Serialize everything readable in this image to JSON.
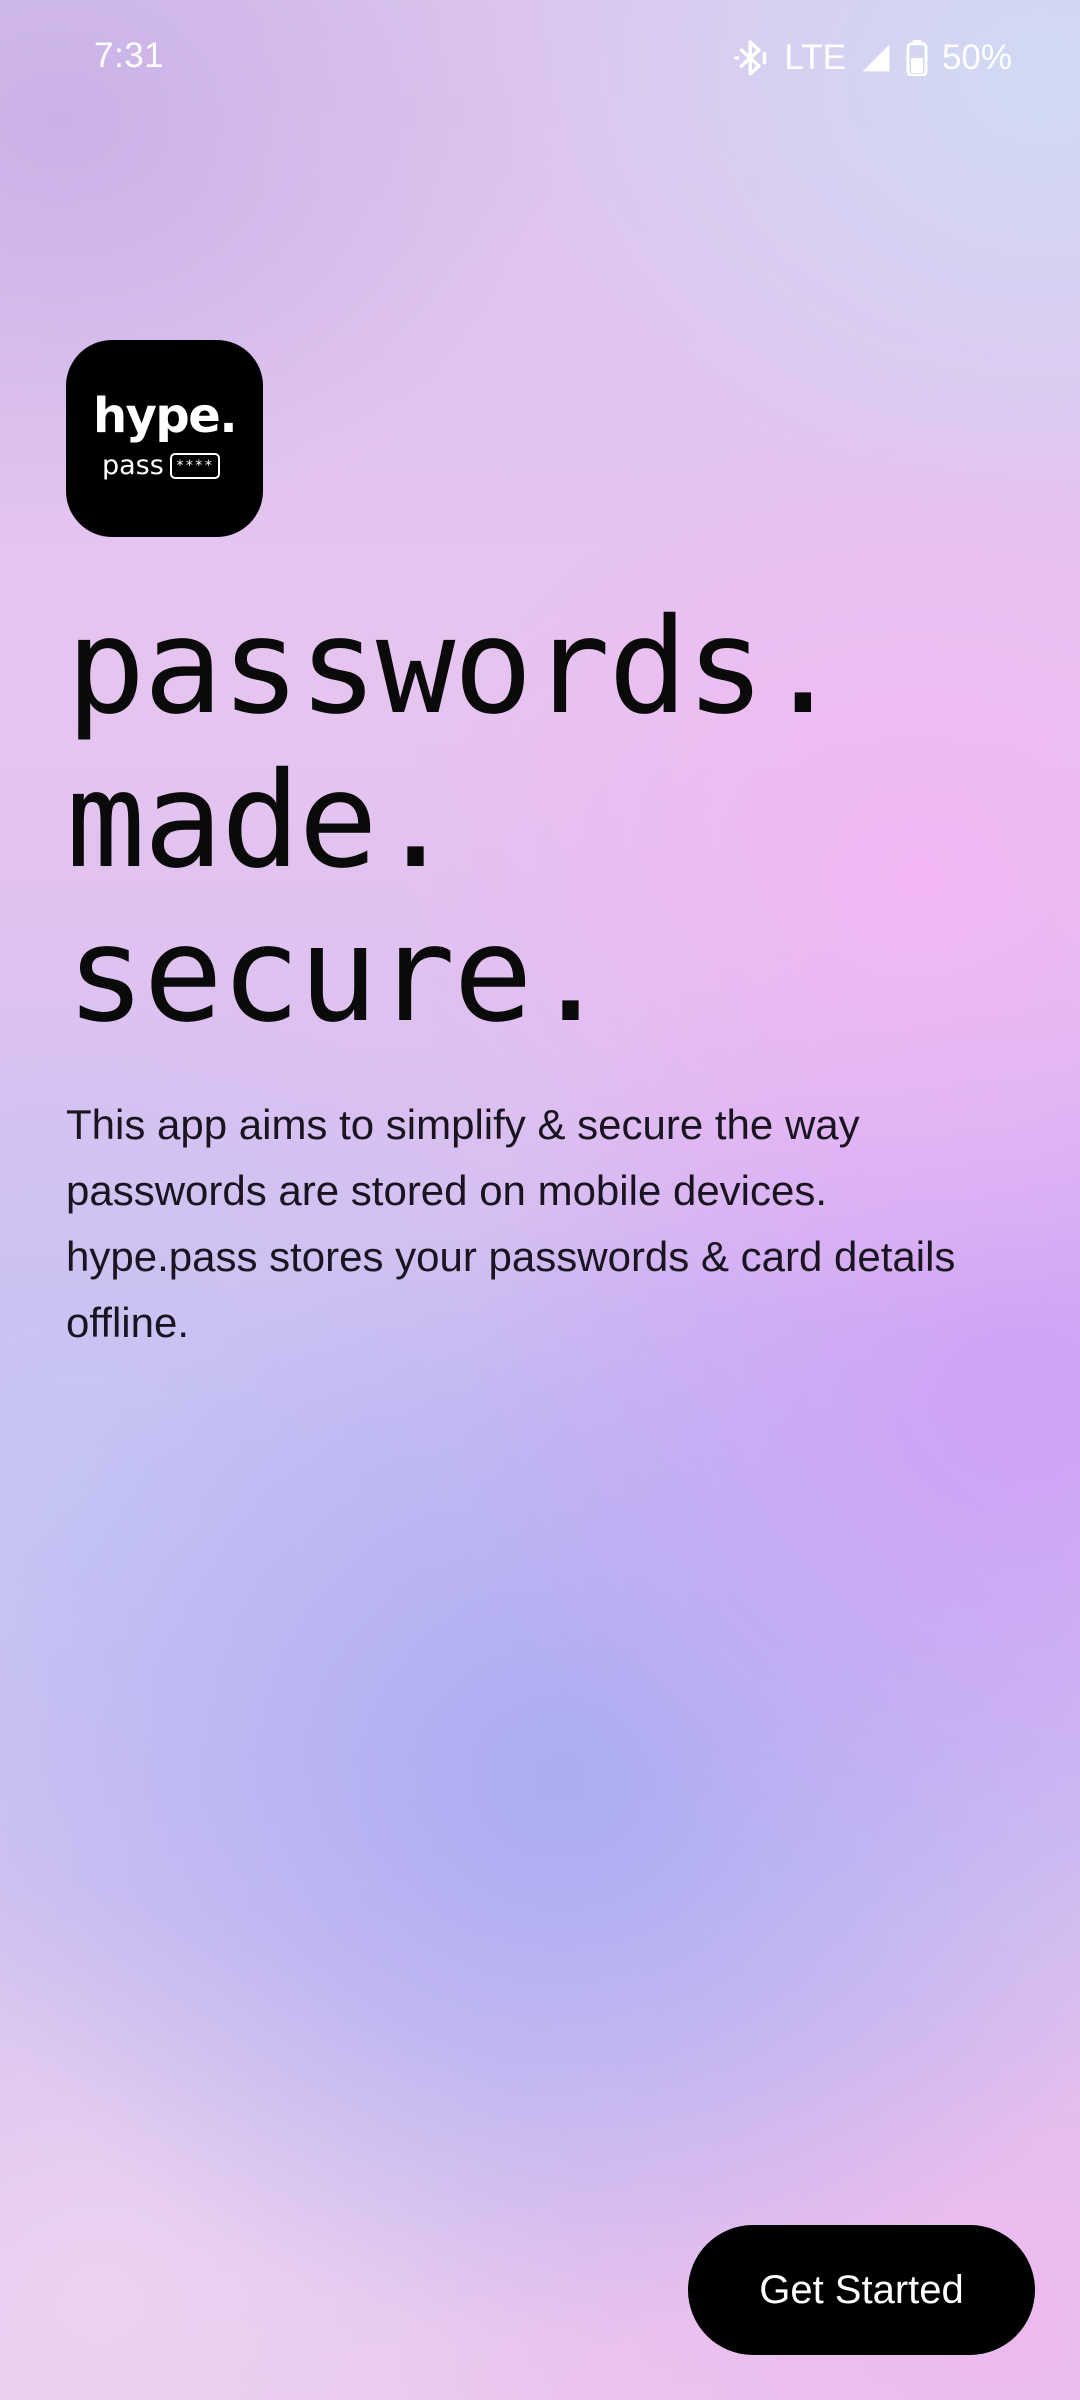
{
  "status_bar": {
    "time": "7:31",
    "network": "LTE",
    "battery": "50%",
    "icons": [
      "bluetooth-icon",
      "signal-icon",
      "battery-icon"
    ]
  },
  "logo": {
    "brand": "hype.",
    "sub": "pass",
    "stars": "****"
  },
  "headline": {
    "line1": "passwords.",
    "line2": "made.",
    "line3": "secure."
  },
  "description": "This app aims to simplify & secure the way passwords are stored on mobile devices. hype.pass stores your passwords & card details offline.",
  "cta": {
    "label": "Get Started"
  },
  "colors": {
    "text": "#0a0a0a",
    "button_bg": "#000000",
    "button_text": "#ffffff",
    "gradient_pink": "#f3b6f4",
    "gradient_violet": "#aaacf2"
  }
}
